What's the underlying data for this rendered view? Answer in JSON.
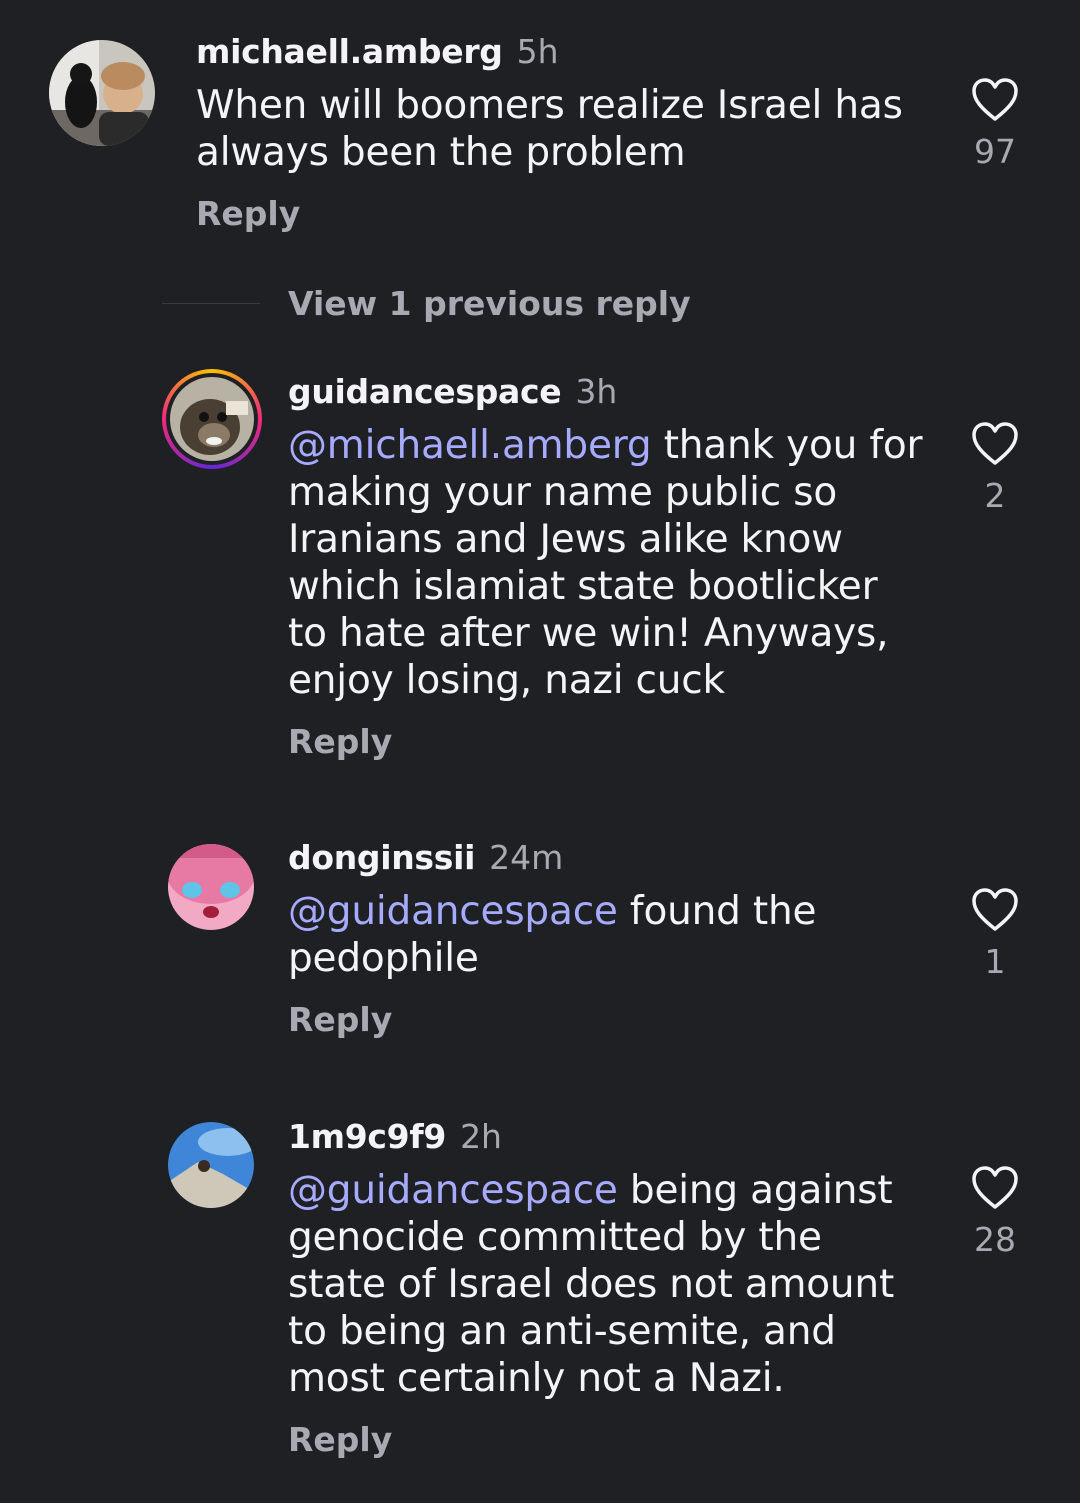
{
  "colors": {
    "background": "#1f2024",
    "text_primary": "#f4f4f6",
    "text_secondary": "#a8aab3",
    "mention": "#a6abff",
    "story_ring": [
      "#f9c300",
      "#ee2a7b",
      "#6228d7"
    ]
  },
  "comments": [
    {
      "username": "michaell.amberg",
      "time": "5h",
      "mention": "",
      "text": "When will boomers realize Israel has always been the problem",
      "reply_label": "Reply",
      "likes": "97",
      "like_icon": "heart-outline-icon"
    },
    {
      "username": "guidancespace",
      "time": "3h",
      "mention": "@michaell.amberg",
      "text": " thank you for making your name public so Iranians and Jews alike know which islamiat state bootlicker to hate after we win! Anyways, enjoy losing, nazi cuck",
      "reply_label": "Reply",
      "likes": "2",
      "like_icon": "heart-outline-icon"
    },
    {
      "username": "donginssii",
      "time": "24m",
      "mention": "@guidancespace",
      "text": " found the pedophile",
      "reply_label": "Reply",
      "likes": "1",
      "like_icon": "heart-outline-icon"
    },
    {
      "username": "1m9c9f9",
      "time": "2h",
      "mention": "@guidancespace",
      "text": " being against genocide committed by the state of Israel does not amount to being an anti-semite, and most certainly not a Nazi.",
      "reply_label": "Reply",
      "likes": "28",
      "like_icon": "heart-outline-icon"
    }
  ],
  "view_previous_label": "View 1 previous reply"
}
